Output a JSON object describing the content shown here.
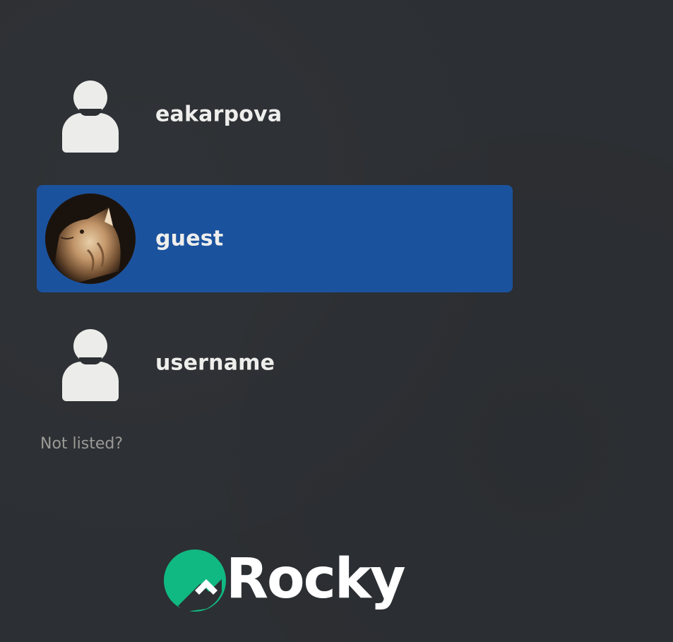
{
  "users": [
    {
      "name": "eakarpova",
      "avatar": "generic-user-icon",
      "selected": false
    },
    {
      "name": "guest",
      "avatar": "cat-photo",
      "selected": true
    },
    {
      "name": "username",
      "avatar": "generic-user-icon",
      "selected": false
    }
  ],
  "not_listed_label": "Not listed?",
  "branding": {
    "logo_text": "Rocky",
    "logo_icon": "rocky-logo-icon",
    "logo_color": "#10b981"
  },
  "colors": {
    "background": "#2c2f33",
    "selected_row": "#1b529e",
    "text": "#eeeeec",
    "muted_text": "#9a9b97"
  }
}
